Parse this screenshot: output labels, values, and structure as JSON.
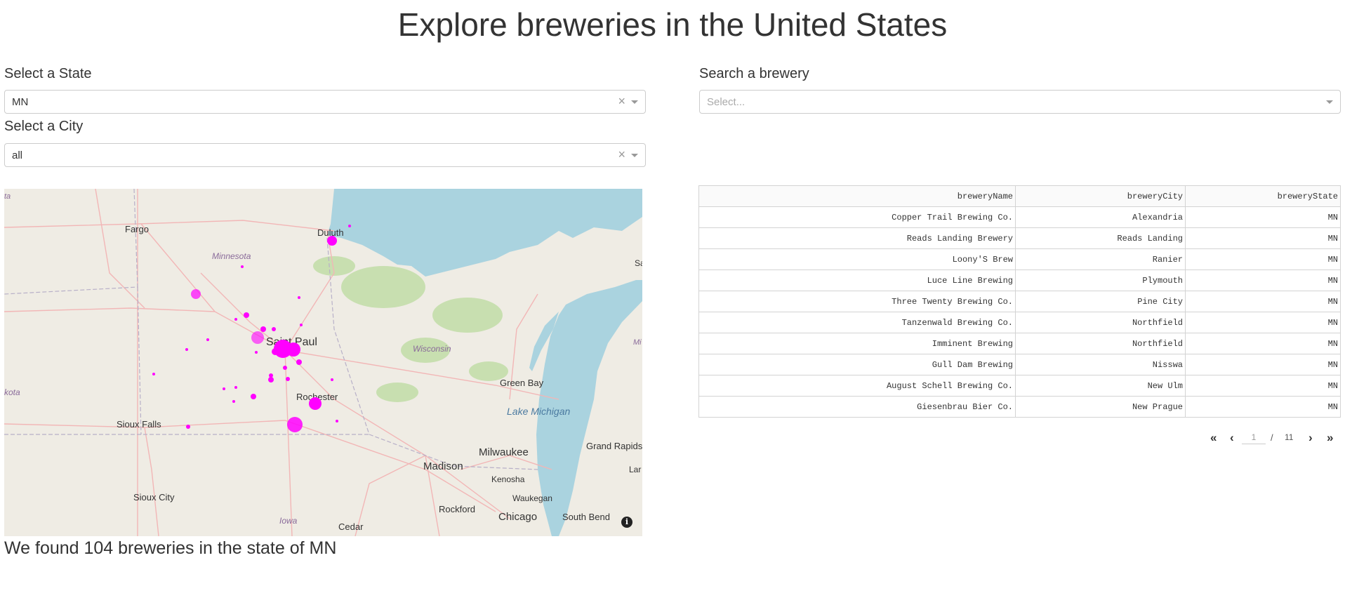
{
  "page": {
    "title": "Explore breweries in the United States"
  },
  "filters": {
    "state_label": "Select a State",
    "state_value": "MN",
    "city_label": "Select a City",
    "city_value": "all",
    "search_label": "Search a brewery",
    "search_placeholder": "Select...",
    "clear_glyph": "×"
  },
  "map": {
    "places": [
      {
        "name": "Fargo"
      },
      {
        "name": "Duluth"
      },
      {
        "name": "Minnesota"
      },
      {
        "name": "Saint Paul"
      },
      {
        "name": "Wisconsin"
      },
      {
        "name": "Rochester"
      },
      {
        "name": "Green Bay"
      },
      {
        "name": "Lake Michigan"
      },
      {
        "name": "Sioux Falls"
      },
      {
        "name": "Milwaukee"
      },
      {
        "name": "Grand Rapids"
      },
      {
        "name": "Madison"
      },
      {
        "name": "Kenosha"
      },
      {
        "name": "Sioux City"
      },
      {
        "name": "Waukegan"
      },
      {
        "name": "Rockford"
      },
      {
        "name": "Chicago"
      },
      {
        "name": "South Bend"
      },
      {
        "name": "Iowa"
      },
      {
        "name": "Cedar"
      },
      {
        "name": "kota"
      },
      {
        "name": "ta"
      },
      {
        "name": "Mi"
      },
      {
        "name": "Sa"
      },
      {
        "name": "Lar"
      }
    ],
    "marker_color": "#ff00ff",
    "info_glyph": "i"
  },
  "summary": {
    "text": "We found 104 breweries in the state of MN"
  },
  "table": {
    "columns": [
      "breweryName",
      "breweryCity",
      "breweryState"
    ],
    "rows": [
      [
        "Copper Trail Brewing Co.",
        "Alexandria",
        "MN"
      ],
      [
        "Reads Landing Brewery",
        "Reads Landing",
        "MN"
      ],
      [
        "Loony'S Brew",
        "Ranier",
        "MN"
      ],
      [
        "Luce Line Brewing",
        "Plymouth",
        "MN"
      ],
      [
        "Three Twenty Brewing Co.",
        "Pine City",
        "MN"
      ],
      [
        "Tanzenwald Brewing Co.",
        "Northfield",
        "MN"
      ],
      [
        "Imminent Brewing",
        "Northfield",
        "MN"
      ],
      [
        "Gull Dam Brewing",
        "Nisswa",
        "MN"
      ],
      [
        "August Schell Brewing Co.",
        "New Ulm",
        "MN"
      ],
      [
        "Giesenbrau Bier Co.",
        "New Prague",
        "MN"
      ]
    ]
  },
  "pager": {
    "first": "«",
    "prev": "‹",
    "current": "1",
    "sep": "/",
    "total": "11",
    "next": "›",
    "last": "»"
  },
  "colors": {
    "water": "#aad3df",
    "land": "#efece4",
    "park": "#c8dfb0",
    "road": "#f2b6b6"
  }
}
